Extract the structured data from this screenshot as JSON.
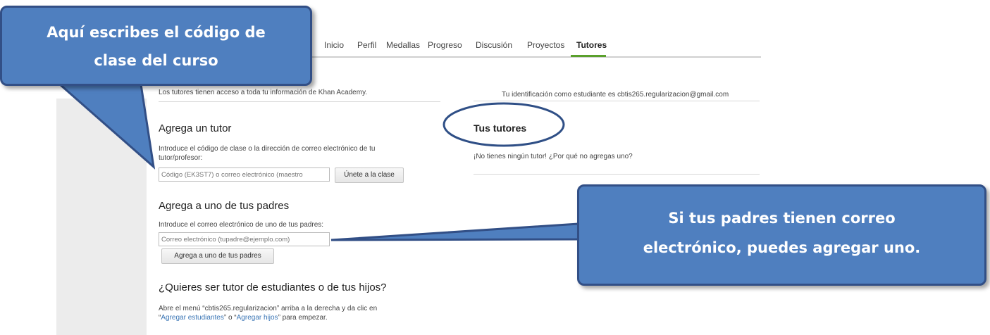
{
  "nav": {
    "items": [
      "Inicio",
      "Perfil",
      "Medallas",
      "Progreso",
      "Discusión",
      "Proyectos",
      "Tutores"
    ],
    "active": "Tutores"
  },
  "info": {
    "access_text": "Los tutores tienen acceso a toda tu información de Khan Academy.",
    "student_id_text": "Tu identificación como estudiante es cbtis265.regularizacion@gmail.com"
  },
  "add_tutor": {
    "title": "Agrega un tutor",
    "description_line1": "Introduce el código de clase o la dirección de correo electrónico de tu",
    "description_line2": "tutor/profesor:",
    "input_placeholder": "Código (EK3ST7) o correo electrónico (maestro",
    "button_label": "Únete a la clase"
  },
  "add_parent": {
    "title": "Agrega a uno de tus padres",
    "description": "Introduce el correo electrónico de uno de tus padres:",
    "input_placeholder": "Correo electrónico (tupadre@ejemplo.com)",
    "button_label": "Agrega a uno de tus padres"
  },
  "become_tutor": {
    "title": "¿Quieres ser tutor de estudiantes o de tus hijos?",
    "line1": "Abre el menú “cbtis265.regularizacion” arriba a la derecha y da clic en",
    "link1": "Agregar estudiantes",
    "middle": "” o “",
    "link2": "Agregar hijos",
    "end": "” para empezar.",
    "open_quote": "“"
  },
  "your_tutors": {
    "title": "Tus tutores",
    "empty_text": "¡No tienes ningún tutor! ¿Por qué no agregas uno?"
  },
  "callouts": {
    "class_code": [
      "Aquí escribes el código de",
      "clase del curso"
    ],
    "parents": [
      "Si tus padres tienen correo",
      "electrónico, puedes agregar uno."
    ]
  },
  "colors": {
    "callout_fill": "#4f7fbf",
    "callout_border": "#324f86",
    "ellipse": "#2f4f86",
    "nav_underline": "#5aa02c"
  }
}
